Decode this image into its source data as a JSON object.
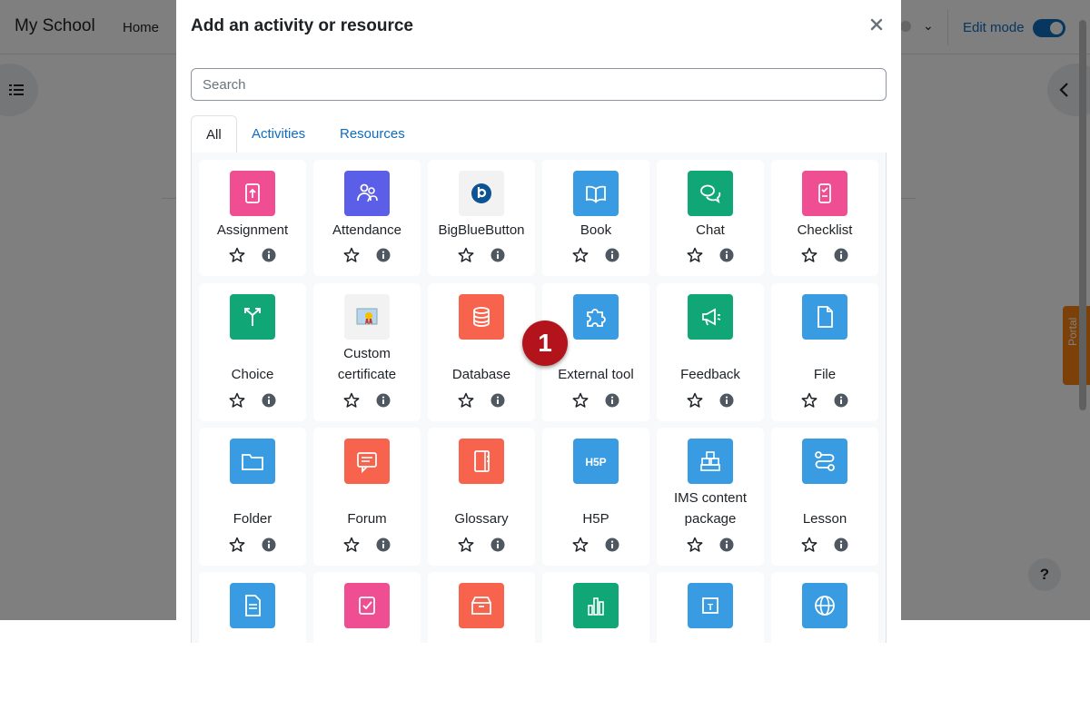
{
  "navbar": {
    "brand": "My School",
    "home": "Home",
    "edit_mode_label": "Edit mode"
  },
  "side_tab_label": "Portal",
  "help_label": "?",
  "modal": {
    "title": "Add an activity or resource",
    "close_icon": "close-icon",
    "search_placeholder": "Search",
    "search_value": "",
    "tabs": [
      {
        "label": "All",
        "active": true
      },
      {
        "label": "Activities",
        "active": false
      },
      {
        "label": "Resources",
        "active": false
      }
    ],
    "tiles": [
      {
        "name": "Assignment",
        "color": "#ef4e92",
        "icon": "assignment-icon"
      },
      {
        "name": "Attendance",
        "color": "#5b5fe8",
        "icon": "attendance-icon"
      },
      {
        "name": "BigBlueButton",
        "color": "#f2f2f2",
        "icon": "bigbluebutton-icon"
      },
      {
        "name": "Book",
        "color": "#399be2",
        "icon": "book-icon"
      },
      {
        "name": "Chat",
        "color": "#11a676",
        "icon": "chat-icon"
      },
      {
        "name": "Checklist",
        "color": "#ef4e92",
        "icon": "checklist-icon"
      },
      {
        "name": "Choice",
        "color": "#11a676",
        "icon": "choice-icon"
      },
      {
        "name": "Custom certificate",
        "color": "#f2f2f2",
        "icon": "certificate-icon"
      },
      {
        "name": "Database",
        "color": "#f7634d",
        "icon": "database-icon"
      },
      {
        "name": "External tool",
        "color": "#399be2",
        "icon": "puzzle-icon"
      },
      {
        "name": "Feedback",
        "color": "#11a676",
        "icon": "megaphone-icon"
      },
      {
        "name": "File",
        "color": "#399be2",
        "icon": "file-icon"
      },
      {
        "name": "Folder",
        "color": "#399be2",
        "icon": "folder-icon"
      },
      {
        "name": "Forum",
        "color": "#f7634d",
        "icon": "forum-icon"
      },
      {
        "name": "Glossary",
        "color": "#f7634d",
        "icon": "glossary-icon"
      },
      {
        "name": "H5P",
        "color": "#399be2",
        "icon": "h5p-icon"
      },
      {
        "name": "IMS content package",
        "color": "#399be2",
        "icon": "ims-package-icon"
      },
      {
        "name": "Lesson",
        "color": "#399be2",
        "icon": "lesson-icon"
      },
      {
        "name": "",
        "color": "#399be2",
        "icon": "page-icon"
      },
      {
        "name": "",
        "color": "#ef4e92",
        "icon": "quiz-icon"
      },
      {
        "name": "",
        "color": "#f7634d",
        "icon": "box-icon"
      },
      {
        "name": "",
        "color": "#11a676",
        "icon": "bar-chart-icon"
      },
      {
        "name": "",
        "color": "#399be2",
        "icon": "text-area-icon"
      },
      {
        "name": "",
        "color": "#399be2",
        "icon": "globe-icon"
      }
    ]
  },
  "step_badge": "1"
}
